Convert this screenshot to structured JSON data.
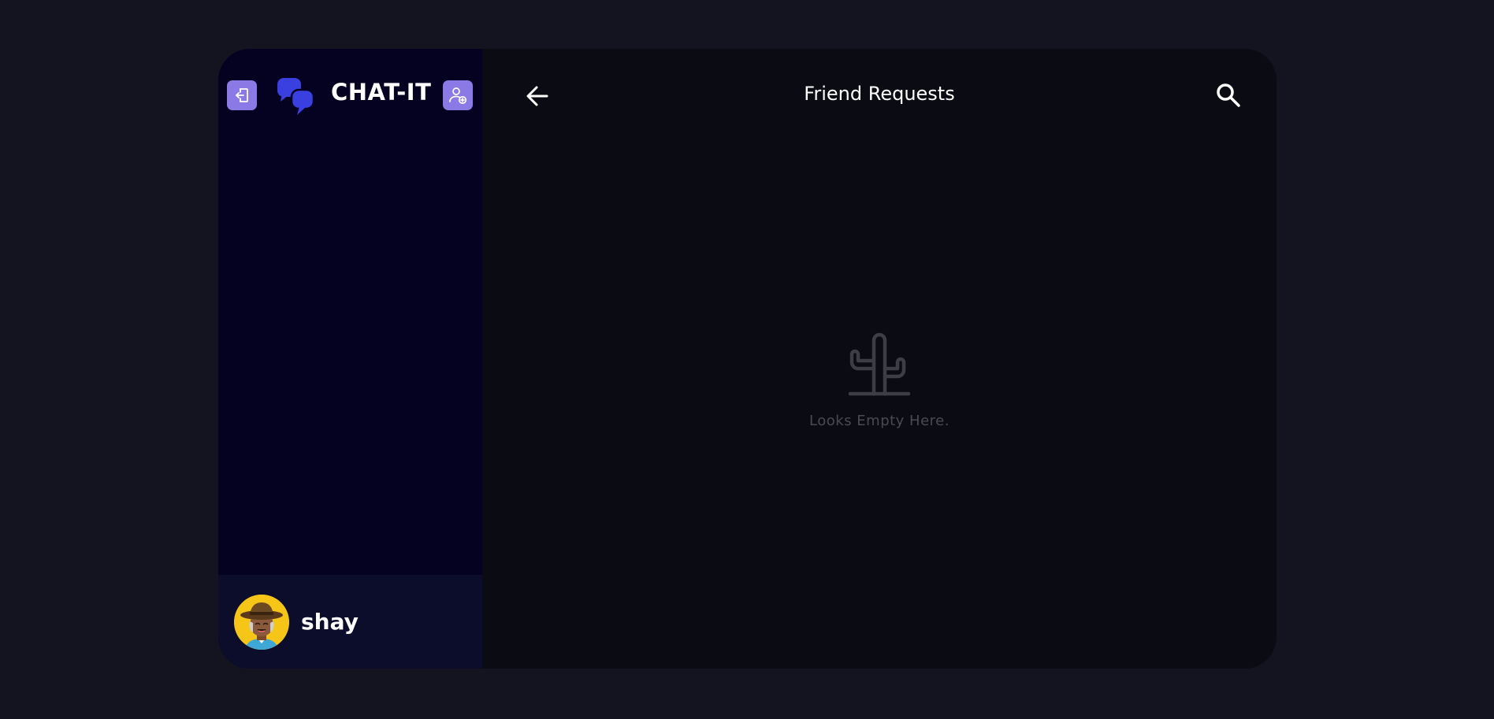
{
  "app": {
    "brand": "CHAT-IT",
    "colors": {
      "page_background": "#141421",
      "sidebar_background": "#050120",
      "main_background": "#0b0b13",
      "user_bar_background": "#0c0c2b",
      "button_accent": "#8b7ae6",
      "logo_blue": "#3a3fe0",
      "avatar_background": "#f5c518",
      "muted_text": "#4a4a52"
    }
  },
  "sidebar": {
    "logout_icon": "logout-icon",
    "add_friend_icon": "add-user-icon",
    "logo_icon": "chat-bubbles-icon",
    "user": {
      "name": "shay",
      "avatar_icon": "cowboy-avatar"
    }
  },
  "main": {
    "title": "Friend Requests",
    "back_icon": "arrow-left-icon",
    "search_icon": "search-icon",
    "empty_state": {
      "icon": "cactus-icon",
      "message": "Looks Empty Here."
    }
  }
}
